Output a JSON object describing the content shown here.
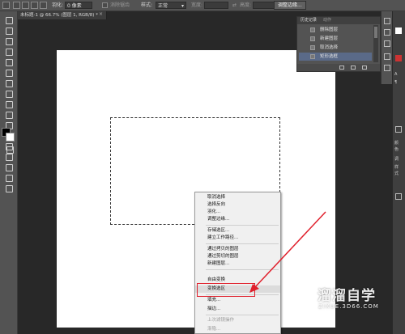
{
  "options_bar": {
    "feather_label": "羽化:",
    "feather_value": "0 像素",
    "anti_alias_label": "消除锯齿",
    "style_label": "样式:",
    "style_value": "正常",
    "width_label": "宽度:",
    "height_label": "高度:",
    "refine_edge_button": "调整边缘..."
  },
  "document_tab": {
    "title": "未标题-1 @ 66.7% (图层 1, RGB/8) *",
    "close": "×"
  },
  "history_panel": {
    "tabs": [
      "历史记录",
      "动作"
    ],
    "items": [
      {
        "label": "删除图层",
        "selected": false
      },
      {
        "label": "新建图层",
        "selected": false
      },
      {
        "label": "取消选择",
        "selected": false
      },
      {
        "label": "矩形选框",
        "selected": true
      }
    ]
  },
  "right_dock": {
    "labels": [
      "A",
      "¶",
      "颜",
      "色",
      "调",
      "样",
      "式"
    ]
  },
  "context_menu": {
    "items": [
      {
        "label": "取消选择",
        "enabled": true
      },
      {
        "label": "选择反向",
        "enabled": true
      },
      {
        "label": "羽化...",
        "enabled": true
      },
      {
        "label": "调整边缘...",
        "enabled": true
      },
      {
        "label": "存储选区...",
        "enabled": true
      },
      {
        "label": "建立工作路径...",
        "enabled": true
      },
      {
        "label": "通过拷贝的图层",
        "enabled": true
      },
      {
        "label": "通过剪切的图层",
        "enabled": true
      },
      {
        "label": "新建图层...",
        "enabled": true
      },
      {
        "label": "自由变换",
        "enabled": true
      },
      {
        "label": "变换选区",
        "enabled": true,
        "highlighted": true
      },
      {
        "label": "填充...",
        "enabled": true
      },
      {
        "label": "描边...",
        "enabled": true
      },
      {
        "label": "上次滤镜操作",
        "enabled": false
      },
      {
        "label": "渐隐...",
        "enabled": false
      }
    ]
  },
  "watermark": {
    "brand": "溜溜自学",
    "url": "ZIXUE.3D66.COM"
  },
  "colors": {
    "annotation_red": "#e0202c",
    "history_selection": "#5a6a88"
  }
}
